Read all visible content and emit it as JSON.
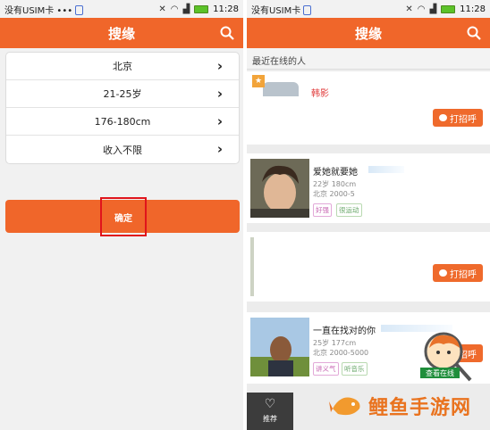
{
  "left": {
    "status": {
      "carrier": "没有USIM卡 •••",
      "time": "11:28"
    },
    "title": "搜缘",
    "filters": [
      {
        "label": "北京"
      },
      {
        "label": "21-25岁"
      },
      {
        "label": "176-180cm"
      },
      {
        "label": "收入不限"
      }
    ],
    "confirm_label": "确定"
  },
  "right": {
    "status": {
      "carrier": "没有USIM卡",
      "time": "11:28"
    },
    "title": "搜缘",
    "section_title": "最近在线的人",
    "users": [
      {
        "name": "韩影",
        "greet": "打招呼"
      },
      {
        "name": "爱她就要她",
        "meta_line1": "22岁 180cm",
        "meta_line2": "北京 2000-5",
        "tags": [
          "好强",
          "很运动"
        ],
        "greet": "打招呼"
      },
      {
        "greet": "打招呼"
      },
      {
        "name": "一直在找对的你",
        "meta_line1": "25岁 177cm",
        "meta_line2": "北京 2000-5000",
        "tags": [
          "讲义气",
          "听音乐"
        ],
        "greet": "打招呼"
      }
    ],
    "tab_label": "推荐",
    "badge_label": "查看在线",
    "crown_glyph": "★"
  },
  "watermark": {
    "text": "鲤鱼手游网"
  },
  "colors": {
    "accent": "#f0662a",
    "highlight": "#e0141b",
    "watermark": "#e9731f"
  }
}
